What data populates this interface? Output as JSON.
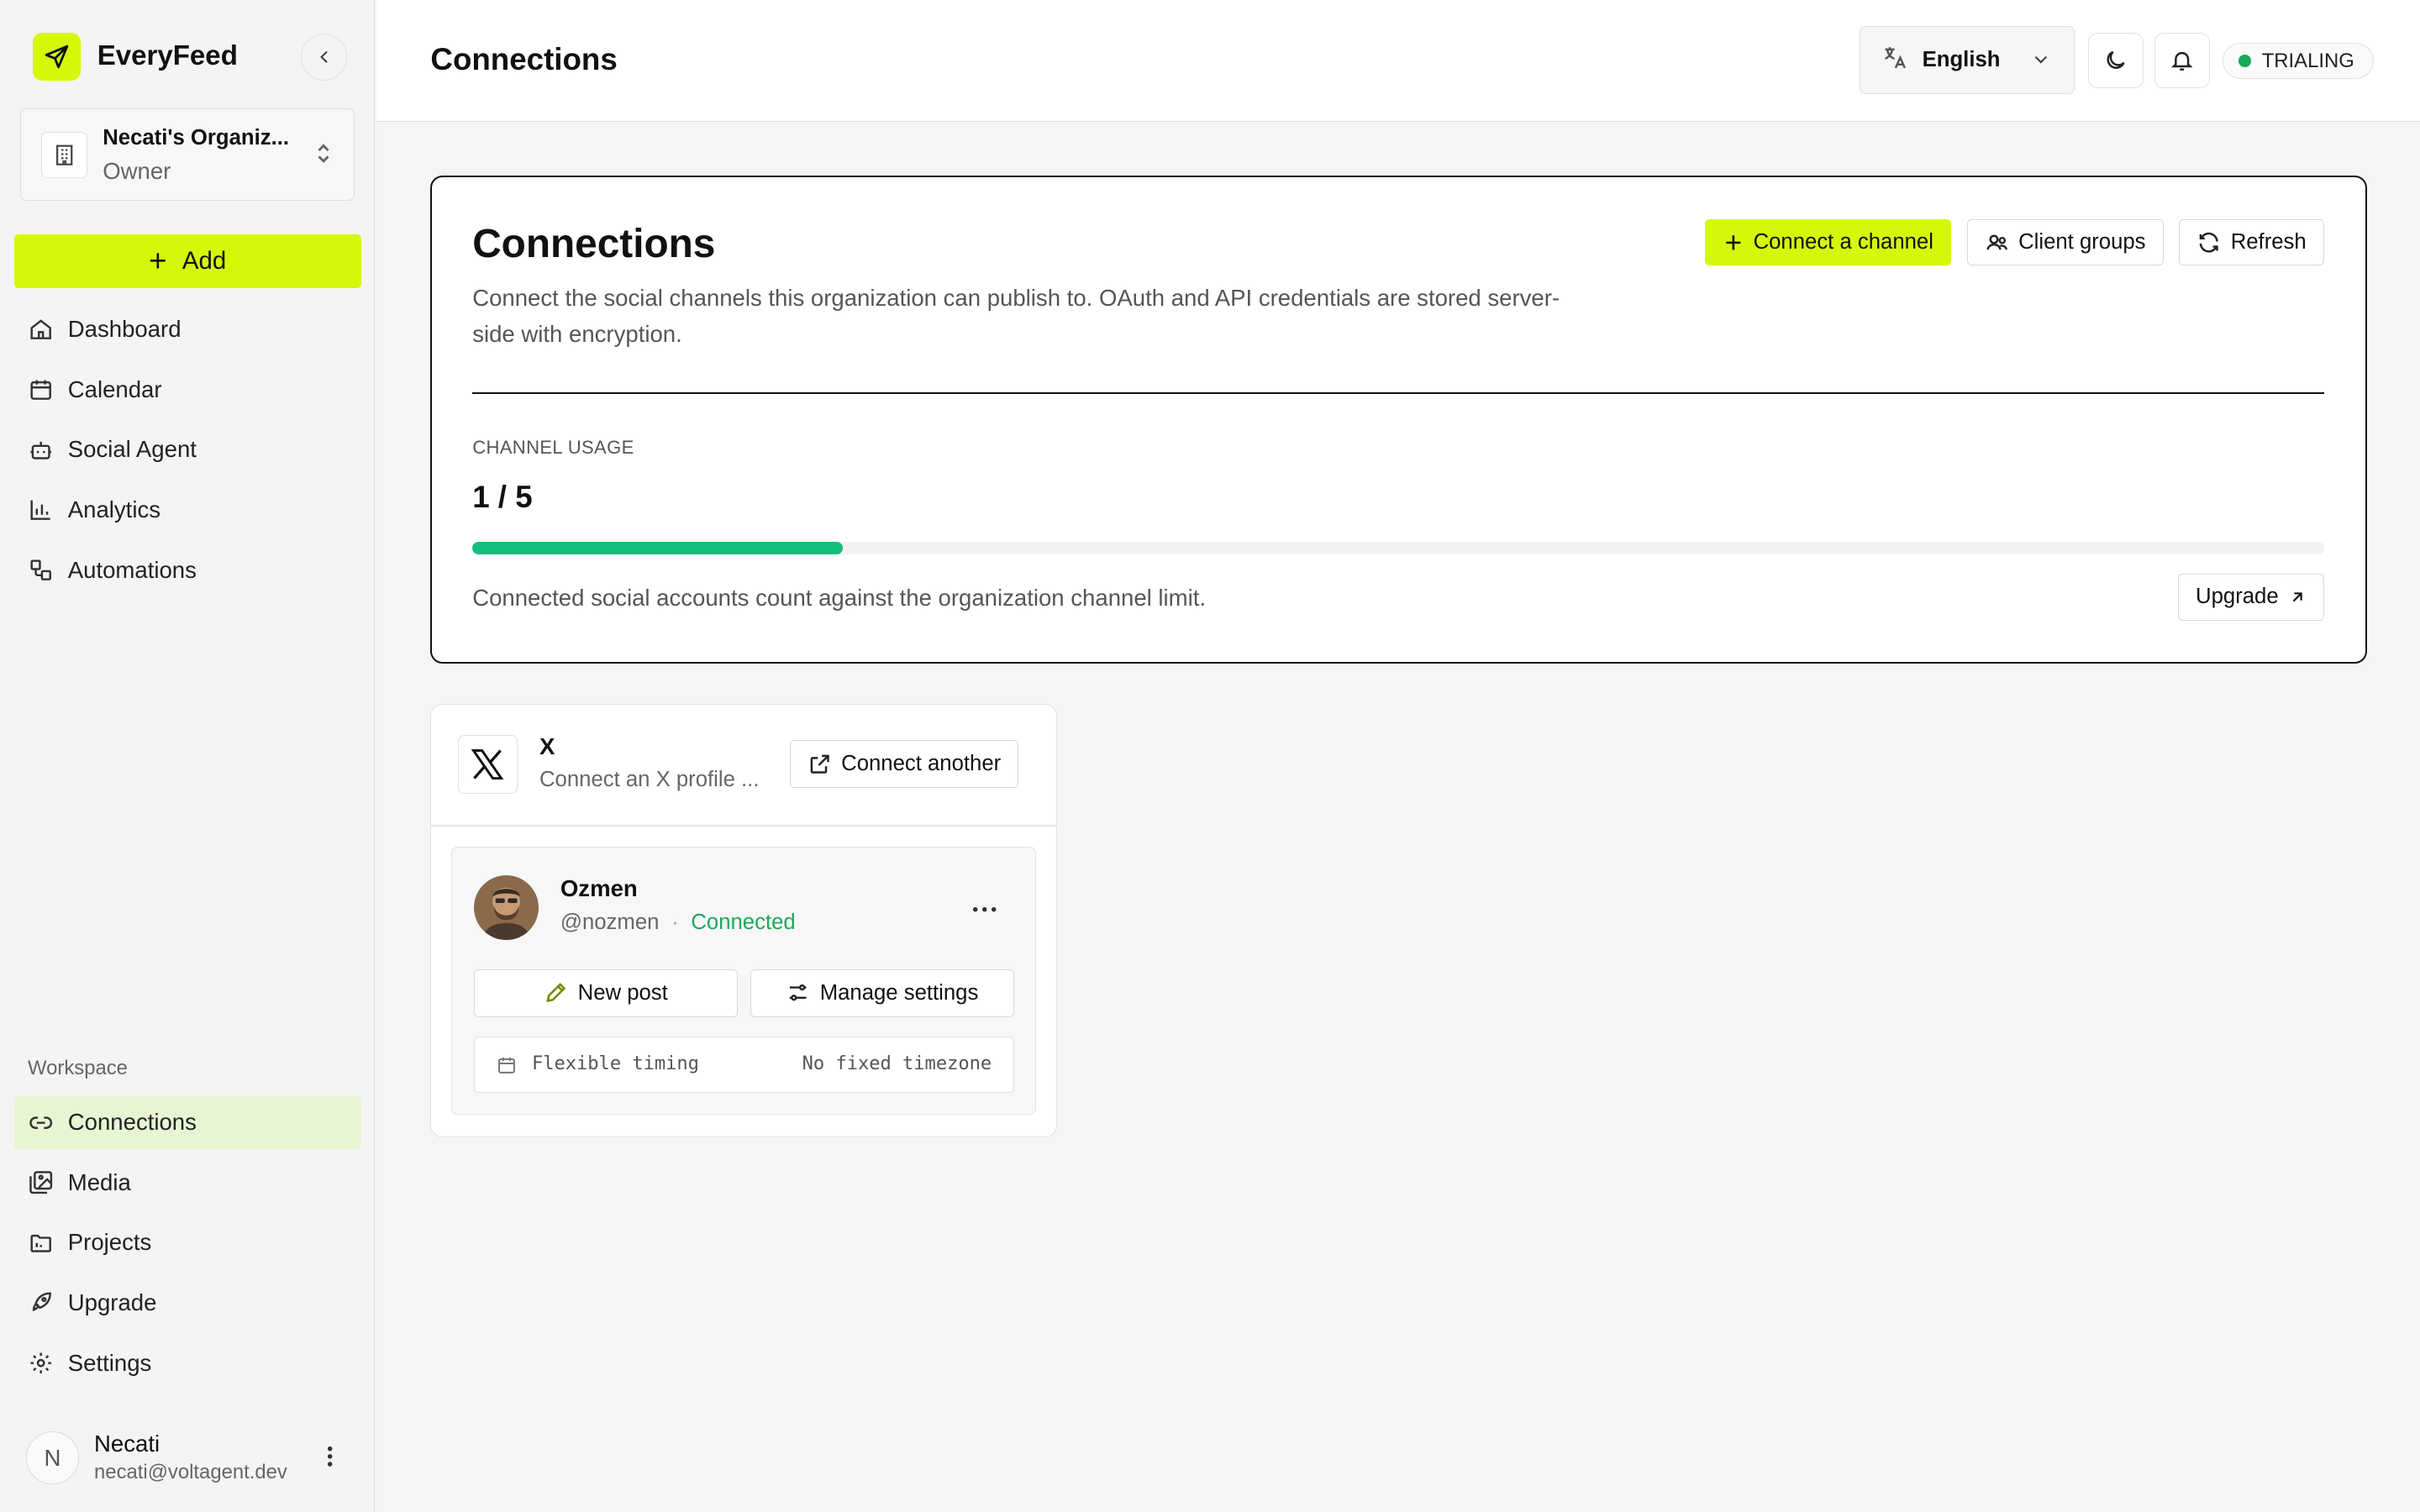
{
  "app": {
    "name": "EveryFeed"
  },
  "org": {
    "name": "Necati's Organiz...",
    "role": "Owner"
  },
  "sidebar": {
    "add_label": "Add",
    "main_items": [
      {
        "label": "Dashboard",
        "icon": "home-icon"
      },
      {
        "label": "Calendar",
        "icon": "calendar-icon"
      },
      {
        "label": "Social Agent",
        "icon": "bot-icon"
      },
      {
        "label": "Analytics",
        "icon": "bar-chart-icon"
      },
      {
        "label": "Automations",
        "icon": "workflow-icon"
      }
    ],
    "section_label": "Workspace",
    "workspace_items": [
      {
        "label": "Connections",
        "icon": "link-icon",
        "active": true
      },
      {
        "label": "Media",
        "icon": "images-icon"
      },
      {
        "label": "Projects",
        "icon": "folder-icon"
      },
      {
        "label": "Upgrade",
        "icon": "rocket-icon"
      },
      {
        "label": "Settings",
        "icon": "gear-icon"
      }
    ]
  },
  "user": {
    "initial": "N",
    "name": "Necati",
    "email": "necati@voltagent.dev"
  },
  "header": {
    "title": "Connections",
    "language": "English",
    "status_badge": "TRIALING",
    "status_color": "#1ba85a"
  },
  "connections": {
    "title": "Connections",
    "description": "Connect the social channels this organization can publish to. OAuth and API credentials are stored server-side with encryption.",
    "actions": {
      "connect": "Connect a channel",
      "client_groups": "Client groups",
      "refresh": "Refresh"
    },
    "usage": {
      "label": "CHANNEL USAGE",
      "count": "1 / 5",
      "fraction": 0.2,
      "note": "Connected social accounts count against the organization channel limit.",
      "upgrade_label": "Upgrade"
    }
  },
  "channel": {
    "name": "X",
    "description": "Connect an X profile ...",
    "connect_label": "Connect another",
    "account": {
      "name": "Ozmen",
      "handle": "@nozmen",
      "separator": "·",
      "status": "Connected",
      "new_post_label": "New post",
      "manage_label": "Manage settings",
      "timing_label": "Flexible timing",
      "timezone_label": "No fixed timezone"
    }
  },
  "colors": {
    "accent": "#d4f70a",
    "progress": "#14bd7b",
    "success": "#1ba85a"
  }
}
